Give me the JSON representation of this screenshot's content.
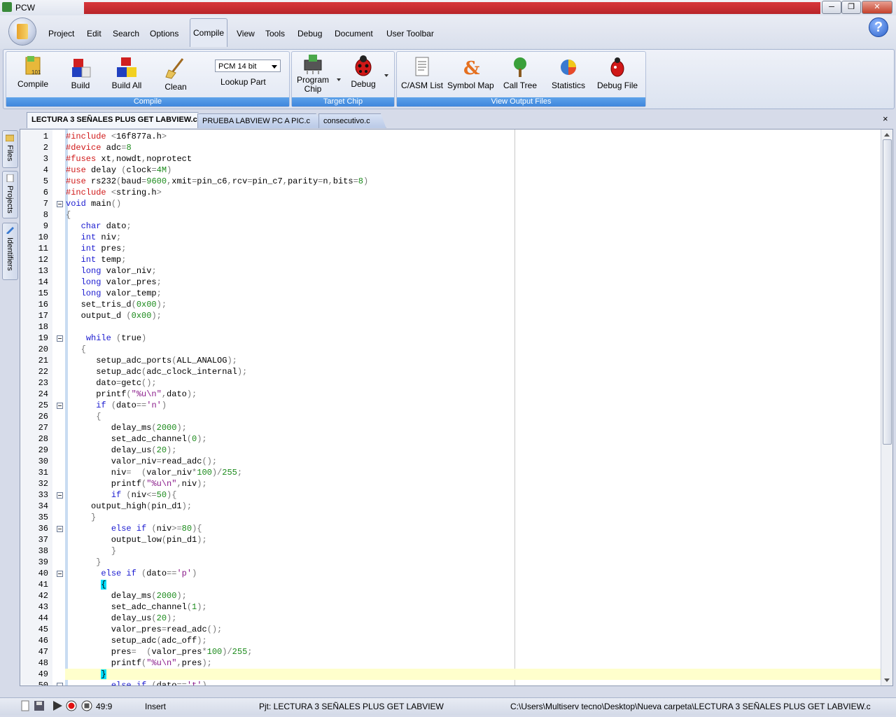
{
  "window": {
    "title": "PCW",
    "minimize": "─",
    "maximize": "❐",
    "close": "✕"
  },
  "menu": [
    "Project",
    "Edit",
    "Search",
    "Options",
    "Compile",
    "View",
    "Tools",
    "Debug",
    "Document",
    "User Toolbar"
  ],
  "help": "?",
  "ribbon": {
    "compile_group": {
      "label": "Compile",
      "buttons": [
        "Compile",
        "Build",
        "Build All",
        "Clean"
      ]
    },
    "part": {
      "selected": "PCM 14 bit",
      "lookup": "Lookup Part"
    },
    "target_group": {
      "label": "Target Chip",
      "program": "Program\nChip",
      "debug": "Debug"
    },
    "output_group": {
      "label": "View Output Files",
      "buttons": [
        "C/ASM List",
        "Symbol Map",
        "Call Tree",
        "Statistics",
        "Debug File"
      ]
    }
  },
  "tabs": [
    "LECTURA 3 SEÑALES PLUS GET LABVIEW.c",
    "PRUEBA LABVIEW PC A PIC.c",
    "consecutivo.c"
  ],
  "tab_close": "×",
  "side_tabs": [
    "Files",
    "Projects",
    "Identifiers"
  ],
  "code": [
    {
      "n": "1",
      "fold": false,
      "t": "<span class=pp>#include</span> <span class=br>&lt;</span>16f877a.h<span class=br>&gt;</span>"
    },
    {
      "n": "2",
      "fold": false,
      "t": "<span class=pp>#device</span> adc<span class=br>=</span><span class=num>8</span>"
    },
    {
      "n": "3",
      "fold": false,
      "t": "<span class=pp>#fuses</span> xt<span class=br>,</span>nowdt<span class=br>,</span>noprotect"
    },
    {
      "n": "4",
      "fold": false,
      "t": "<span class=pp>#use</span> delay <span class=br>(</span>clock<span class=br>=</span><span class=num>4M</span><span class=br>)</span>"
    },
    {
      "n": "5",
      "fold": false,
      "t": "<span class=pp>#use</span> rs232<span class=br>(</span>baud<span class=br>=</span><span class=num>9600</span><span class=br>,</span>xmit<span class=br>=</span>pin_c6<span class=br>,</span>rcv<span class=br>=</span>pin_c7<span class=br>,</span>parity<span class=br>=</span>n<span class=br>,</span>bits<span class=br>=</span><span class=num>8</span><span class=br>)</span>"
    },
    {
      "n": "6",
      "fold": false,
      "t": "<span class=pp>#include</span> <span class=br>&lt;</span>string.h<span class=br>&gt;</span>"
    },
    {
      "n": "7",
      "fold": true,
      "t": "<span class=kw>void</span> main<span class=br>()</span>"
    },
    {
      "n": "8",
      "fold": false,
      "t": "<span class=br>{</span>"
    },
    {
      "n": "9",
      "fold": false,
      "t": "   <span class=kw>char</span> dato<span class=br>;</span>"
    },
    {
      "n": "10",
      "fold": false,
      "t": "   <span class=kw>int</span> niv<span class=br>;</span>"
    },
    {
      "n": "11",
      "fold": false,
      "t": "   <span class=kw>int</span> pres<span class=br>;</span>"
    },
    {
      "n": "12",
      "fold": false,
      "t": "   <span class=kw>int</span> temp<span class=br>;</span>"
    },
    {
      "n": "13",
      "fold": false,
      "t": "   <span class=kw>long</span> valor_niv<span class=br>;</span>"
    },
    {
      "n": "14",
      "fold": false,
      "t": "   <span class=kw>long</span> valor_pres<span class=br>;</span>"
    },
    {
      "n": "15",
      "fold": false,
      "t": "   <span class=kw>long</span> valor_temp<span class=br>;</span>"
    },
    {
      "n": "16",
      "fold": false,
      "t": "   set_tris_d<span class=br>(</span><span class=num>0x00</span><span class=br>);</span>"
    },
    {
      "n": "17",
      "fold": false,
      "t": "   output_d <span class=br>(</span><span class=num>0x00</span><span class=br>);</span>"
    },
    {
      "n": "18",
      "fold": false,
      "t": ""
    },
    {
      "n": "19",
      "fold": true,
      "t": "    <span class=kw>while</span> <span class=br>(</span>true<span class=br>)</span>"
    },
    {
      "n": "20",
      "fold": false,
      "t": "   <span class=br>{</span>"
    },
    {
      "n": "21",
      "fold": false,
      "t": "      setup_adc_ports<span class=br>(</span>ALL_ANALOG<span class=br>);</span>"
    },
    {
      "n": "22",
      "fold": false,
      "t": "      setup_adc<span class=br>(</span>adc_clock_internal<span class=br>);</span>"
    },
    {
      "n": "23",
      "fold": false,
      "t": "      dato<span class=br>=</span>getc<span class=br>();</span>"
    },
    {
      "n": "24",
      "fold": false,
      "t": "      printf<span class=br>(</span><span class=str>\"%u\\n\"</span><span class=br>,</span>dato<span class=br>);</span>"
    },
    {
      "n": "25",
      "fold": true,
      "t": "      <span class=kw>if</span> <span class=br>(</span>dato<span class=br>==</span><span class=str>'n'</span><span class=br>)</span>"
    },
    {
      "n": "26",
      "fold": false,
      "t": "      <span class=br>{</span>"
    },
    {
      "n": "27",
      "fold": false,
      "t": "         delay_ms<span class=br>(</span><span class=num>2000</span><span class=br>);</span>"
    },
    {
      "n": "28",
      "fold": false,
      "t": "         set_adc_channel<span class=br>(</span><span class=num>0</span><span class=br>);</span>"
    },
    {
      "n": "29",
      "fold": false,
      "t": "         delay_us<span class=br>(</span><span class=num>20</span><span class=br>);</span>"
    },
    {
      "n": "30",
      "fold": false,
      "t": "         valor_niv<span class=br>=</span>read_adc<span class=br>();</span>"
    },
    {
      "n": "31",
      "fold": false,
      "t": "         niv<span class=br>=</span>  <span class=br>(</span>valor_niv<span class=br>*</span><span class=num>100</span><span class=br>)/</span><span class=num>255</span><span class=br>;</span>"
    },
    {
      "n": "32",
      "fold": false,
      "t": "         printf<span class=br>(</span><span class=str>\"%u\\n\"</span><span class=br>,</span>niv<span class=br>);</span>"
    },
    {
      "n": "33",
      "fold": true,
      "t": "         <span class=kw>if</span> <span class=br>(</span>niv<span class=br>&lt;=</span><span class=num>50</span><span class=br>){</span>"
    },
    {
      "n": "34",
      "fold": false,
      "t": "     output_high<span class=br>(</span>pin_d1<span class=br>);</span>"
    },
    {
      "n": "35",
      "fold": false,
      "t": "     <span class=br>}</span>"
    },
    {
      "n": "36",
      "fold": true,
      "t": "         <span class=kw>else if</span> <span class=br>(</span>niv<span class=br>&gt;=</span><span class=num>80</span><span class=br>){</span>"
    },
    {
      "n": "37",
      "fold": false,
      "t": "         output_low<span class=br>(</span>pin_d1<span class=br>);</span>"
    },
    {
      "n": "38",
      "fold": false,
      "t": "         <span class=br>}</span>"
    },
    {
      "n": "39",
      "fold": false,
      "t": "      <span class=br>}</span>"
    },
    {
      "n": "40",
      "fold": true,
      "t": "       <span class=kw>else if</span> <span class=br>(</span>dato<span class=br>==</span><span class=str>'p'</span><span class=br>)</span>"
    },
    {
      "n": "41",
      "fold": false,
      "t": "       <span class=cyan>{</span>"
    },
    {
      "n": "42",
      "fold": false,
      "t": "         delay_ms<span class=br>(</span><span class=num>2000</span><span class=br>);</span>"
    },
    {
      "n": "43",
      "fold": false,
      "t": "         set_adc_channel<span class=br>(</span><span class=num>1</span><span class=br>);</span>"
    },
    {
      "n": "44",
      "fold": false,
      "t": "         delay_us<span class=br>(</span><span class=num>20</span><span class=br>);</span>"
    },
    {
      "n": "45",
      "fold": false,
      "t": "         valor_pres<span class=br>=</span>read_adc<span class=br>();</span>"
    },
    {
      "n": "46",
      "fold": false,
      "t": "         setup_adc<span class=br>(</span>adc_off<span class=br>);</span>"
    },
    {
      "n": "47",
      "fold": false,
      "t": "         pres<span class=br>=</span>  <span class=br>(</span>valor_pres<span class=br>*</span><span class=num>100</span><span class=br>)/</span><span class=num>255</span><span class=br>;</span>"
    },
    {
      "n": "48",
      "fold": false,
      "t": "         printf<span class=br>(</span><span class=str>\"%u\\n\"</span><span class=br>,</span>pres<span class=br>);</span>"
    },
    {
      "n": "49",
      "fold": false,
      "t": "       <span class=cyan>}</span>"
    },
    {
      "n": "50",
      "fold": true,
      "t": "         <span class=kw>else if</span> <span class=br>(</span>dato<span class=br>==</span><span class=str>'t'</span><span class=br>)</span>"
    }
  ],
  "current_line": "49",
  "status": {
    "position": "49:9",
    "mode": "Insert",
    "project": "Pjt: LECTURA 3 SEÑALES PLUS GET LABVIEW",
    "path": "C:\\Users\\Multiserv tecno\\Desktop\\Nueva carpeta\\LECTURA 3 SEÑALES PLUS GET LABVIEW.c"
  }
}
